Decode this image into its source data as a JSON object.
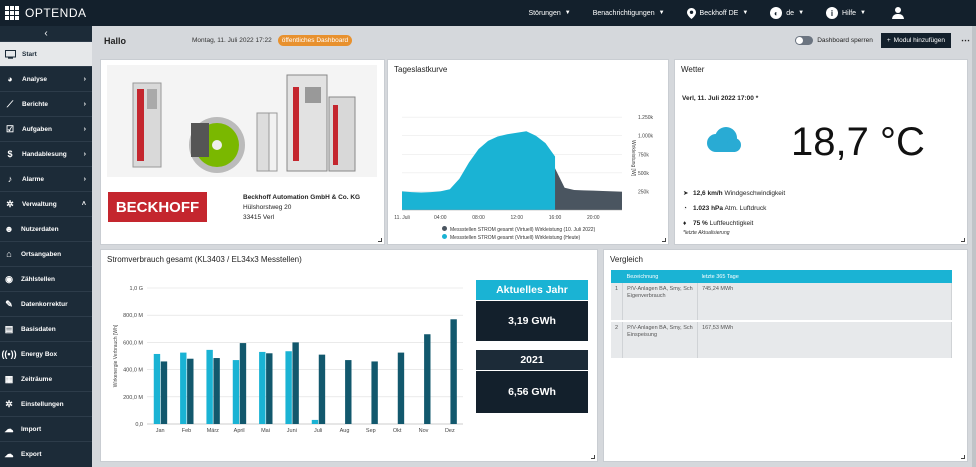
{
  "app": {
    "name": "OPTENDA"
  },
  "topnav": {
    "stoerungen": "Störungen",
    "benachrichtigungen": "Benachrichtigungen",
    "company": "Beckhoff DE",
    "language": "de",
    "help": "Hilfe"
  },
  "sidebar": {
    "items": [
      {
        "label": "Start",
        "icon": "monitor-icon"
      },
      {
        "label": "Analyse",
        "icon": "pie-chart-icon"
      },
      {
        "label": "Berichte",
        "icon": "line-chart-icon"
      },
      {
        "label": "Aufgaben",
        "icon": "checkbox-icon"
      },
      {
        "label": "Handablesung",
        "icon": "dollar-icon"
      },
      {
        "label": "Alarme",
        "icon": "bell-icon"
      },
      {
        "label": "Verwaltung",
        "icon": "gears-icon"
      },
      {
        "label": "Nutzerdaten",
        "icon": "users-icon"
      },
      {
        "label": "Ortsangaben",
        "icon": "home-icon"
      },
      {
        "label": "Zählstellen",
        "icon": "meter-icon"
      },
      {
        "label": "Datenkorrektur",
        "icon": "wrench-icon"
      },
      {
        "label": "Basisdaten",
        "icon": "book-icon"
      },
      {
        "label": "Energy Box",
        "icon": "signal-icon"
      },
      {
        "label": "Zeiträume",
        "icon": "calendar-icon"
      },
      {
        "label": "Einstellungen",
        "icon": "settings-icon"
      },
      {
        "label": "Import",
        "icon": "cloud-upload-icon"
      },
      {
        "label": "Export",
        "icon": "cloud-download-icon"
      }
    ]
  },
  "header": {
    "greeting": "Hallo",
    "date": "Montag, 11. Juli 2022 17:22",
    "badge": "öffentliches Dashboard",
    "lock_label": "Dashboard sperren",
    "add_module": "Modul hinzufügen"
  },
  "company_card": {
    "logo_text": "BECKHOFF",
    "name": "Beckhoff Automation GmbH & Co. KG",
    "street": "Hülshorstweg 20",
    "city": "33415 Verl"
  },
  "load_curve": {
    "title": "Tageslastkurve",
    "y_ticks": [
      "1.250k",
      "1.000k",
      "750k",
      "500k",
      "250k"
    ],
    "y_label": "Wirkleistung [W]",
    "x_ticks": [
      "11. Juli",
      "04:00",
      "08:00",
      "12:00",
      "16:00",
      "20:00"
    ],
    "legend": [
      {
        "label": "Messstellen STROM gesamt (Virtuell) Wirkleistung (10. Juli 2022)",
        "color": "#4a5560"
      },
      {
        "label": "Messstellen STROM gesamt (Virtuell) Wirkleistung (Heute)",
        "color": "#1ab3d4"
      }
    ]
  },
  "weather": {
    "title": "Wetter",
    "location_time": "Verl, 11. Juli 2022 17:00 *",
    "temperature": "18,7 °C",
    "wind_value": "12,6 km/h",
    "wind_label": "Windgeschwindigkeit",
    "pressure_value": "1.023 hPa",
    "pressure_label": "Atm. Luftdruck",
    "humidity_value": "75 %",
    "humidity_label": "Luftfeuchtigkeit",
    "footnote": "*letzte Aktualisierung"
  },
  "consumption": {
    "title": "Stromverbrauch gesamt (KL3403 / EL34x3 Messtellen)",
    "kpi_current_label": "Aktuelles Jahr",
    "kpi_current_value": "3,19 GWh",
    "kpi_prev_year": "2021",
    "kpi_prev_value": "6,56 GWh"
  },
  "comparison": {
    "title": "Vergleich",
    "headers": [
      "",
      "Bezeichnung",
      "letzte 365 Tage"
    ],
    "rows": [
      {
        "num": "1",
        "name": "P/V-Anlagen BA, Smy, Sch Eigenverbrauch",
        "value": "745,24 MWh"
      },
      {
        "num": "2",
        "name": "P/V-Anlagen BA, Smy, Sch Einspeisung",
        "value": "167,53 MWh"
      }
    ]
  },
  "chart_data": [
    {
      "type": "bar",
      "title": "Stromverbrauch gesamt (KL3403 / EL34x3 Messtellen)",
      "ylabel": "Wirkenergie Verbrauch [Wh]",
      "y_tick_labels": [
        "0,0",
        "200,0 M",
        "400,0 M",
        "600,0 M",
        "800,0 M",
        "1,0 G"
      ],
      "ylim": [
        0,
        1000
      ],
      "unit": "MWh",
      "categories": [
        "Jan",
        "Feb",
        "März",
        "April",
        "Mai",
        "Juni",
        "Juli",
        "Aug",
        "Sep",
        "Okt",
        "Nov",
        "Dez"
      ],
      "series": [
        {
          "color": "#1ab3d4",
          "values": [
            515,
            525,
            545,
            470,
            530,
            535,
            30,
            0,
            0,
            0,
            0,
            0
          ]
        },
        {
          "color": "#12586d",
          "values": [
            460,
            480,
            485,
            595,
            520,
            600,
            510,
            470,
            460,
            525,
            660,
            770
          ]
        }
      ]
    },
    {
      "type": "area",
      "title": "Tageslastkurve",
      "ylabel": "Wirkleistung [W]",
      "ylim": [
        0,
        1400
      ],
      "unit": "kW",
      "x": [
        "00:00",
        "01:00",
        "02:00",
        "03:00",
        "04:00",
        "05:00",
        "06:00",
        "07:00",
        "08:00",
        "09:00",
        "10:00",
        "11:00",
        "12:00",
        "13:00",
        "14:00",
        "15:00",
        "16:00",
        "17:00",
        "18:00",
        "19:00",
        "20:00",
        "21:00",
        "22:00",
        "23:00"
      ],
      "series": [
        {
          "name": "Messstellen STROM gesamt (Virtuell) Wirkleistung (10. Juli 2022)",
          "color": "#4a5560",
          "values": [
            240,
            230,
            225,
            235,
            230,
            240,
            330,
            470,
            600,
            700,
            760,
            800,
            820,
            800,
            780,
            700,
            560,
            300,
            270,
            265,
            260,
            255,
            250,
            245
          ]
        },
        {
          "name": "Messstellen STROM gesamt (Virtuell) Wirkleistung (Heute)",
          "color": "#1ab3d4",
          "values": [
            250,
            240,
            235,
            240,
            250,
            280,
            420,
            640,
            820,
            930,
            990,
            1020,
            1040,
            1060,
            1000,
            900,
            720,
            0,
            0,
            0,
            0,
            0,
            0,
            0
          ]
        }
      ]
    }
  ]
}
